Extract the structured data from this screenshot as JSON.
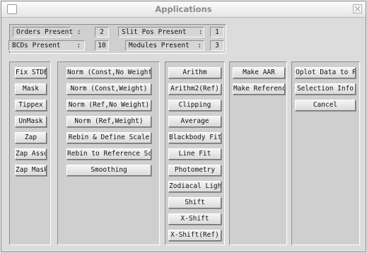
{
  "window": {
    "title": "Applications"
  },
  "info": {
    "orders_label": "Orders Present :",
    "orders_value": "2",
    "slitpos_label": "Slit Pos Present   :",
    "slitpos_value": "1",
    "bcds_label": "BCDs Present    :",
    "bcds_value": "10",
    "modules_label": "Modules Present  :",
    "modules_value": "3"
  },
  "col1": [
    "Fix STDEV",
    "Mask",
    "Tippex",
    "UnMask",
    "Zap",
    "Zap Assoc",
    "Zap Masked"
  ],
  "col2": [
    "Norm (Const,No Weight)",
    "Norm (Const,Weight)",
    "Norm (Ref,No Weight)",
    "Norm (Ref,Weight)",
    "Rebin & Define Scale",
    "Rebin to Reference Scale",
    "Smoothing"
  ],
  "col3": [
    "Arithm",
    "Arithm2(Ref)",
    "Clipping",
    "Average",
    "Blackbody Fit",
    "Line Fit",
    "Photometry",
    "Zodiacal Light",
    "Shift",
    "X-Shift",
    "X-Shift(Ref)"
  ],
  "col4": [
    "Make AAR",
    "Make Reference"
  ],
  "col5": [
    "Oplot Data to Ref",
    "Selection Info",
    "Cancel"
  ],
  "icons": {
    "close": "close-icon",
    "checkbox": "window-checkbox-icon"
  }
}
